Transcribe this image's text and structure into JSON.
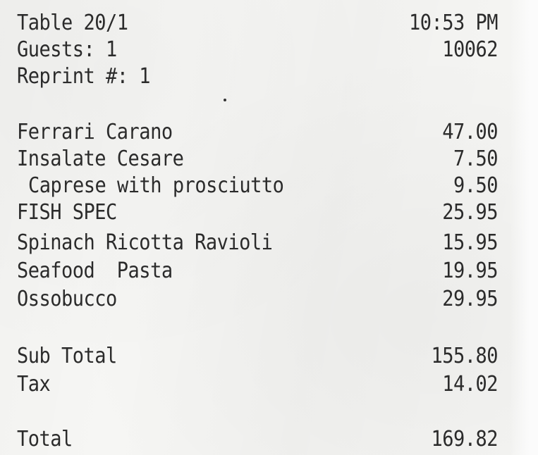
{
  "header": {
    "table": "Table 20/1",
    "time": "10:53 PM",
    "guests": "Guests: 1",
    "check_number": "10062",
    "reprint": "Reprint #: 1"
  },
  "items": [
    {
      "name": "Ferrari Carano",
      "price": "47.00"
    },
    {
      "name": "Insalate Cesare",
      "price": "7.50"
    },
    {
      "name": "Caprese with prosciutto",
      "price": "9.50"
    },
    {
      "name": "FISH SPEC",
      "price": "25.95"
    },
    {
      "name": "Spinach Ricotta Ravioli",
      "price": "15.95"
    },
    {
      "name": "Seafood  Pasta",
      "price": "19.95"
    },
    {
      "name": "Ossobucco",
      "price": "29.95"
    }
  ],
  "totals": {
    "subtotal_label": "Sub Total",
    "subtotal_value": "155.80",
    "tax_label": "Tax",
    "tax_value": "14.02",
    "total_label": "Total",
    "total_value": "169.82"
  }
}
